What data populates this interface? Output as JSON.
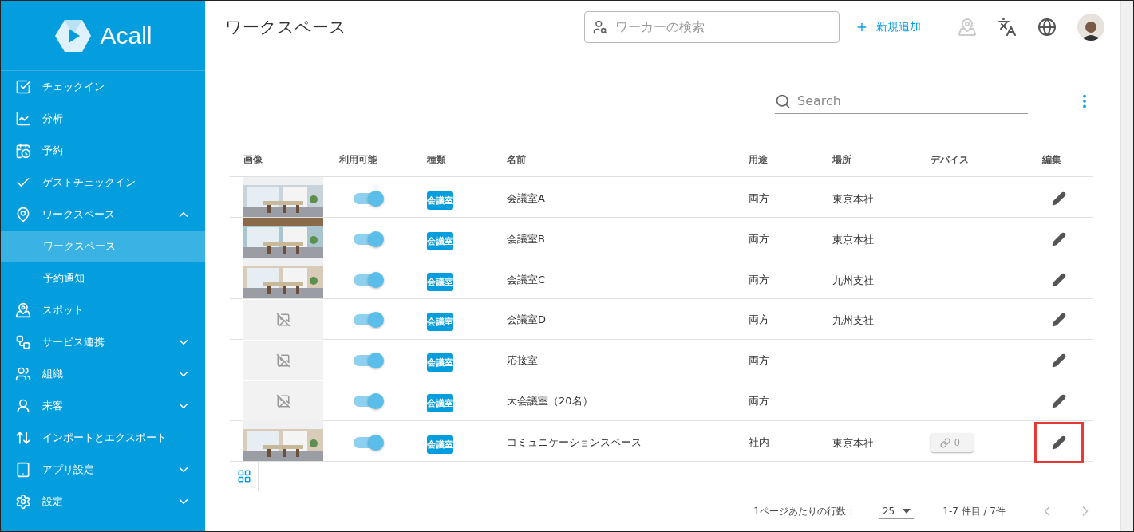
{
  "logo": {
    "text": "Acall"
  },
  "sidebar": {
    "items": [
      {
        "label": "チェックイン"
      },
      {
        "label": "分析"
      },
      {
        "label": "予約"
      },
      {
        "label": "ゲストチェックイン"
      },
      {
        "label": "ワークスペース",
        "expanded": true,
        "children": [
          {
            "label": "ワークスペース",
            "selected": true
          },
          {
            "label": "予約通知",
            "selected": false
          }
        ]
      },
      {
        "label": "スポット"
      },
      {
        "label": "サービス連携",
        "expanded": false
      },
      {
        "label": "組織",
        "expanded": false
      },
      {
        "label": "来客",
        "expanded": false
      },
      {
        "label": "インポートとエクスポート"
      },
      {
        "label": "アプリ設定",
        "expanded": false
      },
      {
        "label": "設定",
        "expanded": false
      }
    ]
  },
  "header": {
    "title": "ワークスペース",
    "worker_search": {
      "placeholder": "ワーカーの検索"
    },
    "add_button": "新規追加"
  },
  "table_search": {
    "placeholder": "Search"
  },
  "table": {
    "columns": [
      "画像",
      "利用可能",
      "種類",
      "名前",
      "用途",
      "場所",
      "デバイス",
      "編集"
    ],
    "rows": [
      {
        "available": true,
        "type": "会議室",
        "name": "会議室A",
        "usage": "両方",
        "place": "東京本社",
        "highlighted": false
      },
      {
        "available": true,
        "type": "会議室",
        "name": "会議室B",
        "usage": "両方",
        "place": "東京本社",
        "highlighted": false
      },
      {
        "available": true,
        "type": "会議室",
        "name": "会議室C",
        "usage": "両方",
        "place": "九州支社",
        "highlighted": false
      },
      {
        "available": true,
        "type": "会議室",
        "name": "会議室D",
        "usage": "両方",
        "place": "九州支社",
        "highlighted": false
      },
      {
        "available": true,
        "type": "会議室",
        "name": "応接室",
        "usage": "両方",
        "highlighted": false
      },
      {
        "available": true,
        "type": "会議室",
        "name": "大会議室（20名）",
        "usage": "両方",
        "highlighted": false
      },
      {
        "available": true,
        "type": "会議室",
        "name": "コミュニケーションスペース",
        "usage": "社内",
        "place": "東京本社",
        "device": "0",
        "highlighted": true
      }
    ]
  },
  "pagination": {
    "rows_label": "1ページあたりの行数：",
    "rows_per_page": "25",
    "range": "1-7 件目 / 7件"
  }
}
